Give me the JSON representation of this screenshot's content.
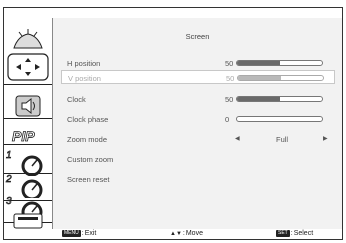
{
  "menu": {
    "title": "Screen",
    "items": [
      {
        "label": "H position",
        "value": "50",
        "level": 0.5
      },
      {
        "label": "V position",
        "value": "50",
        "level": 0.5
      },
      {
        "label": "Clock",
        "value": "50",
        "level": 0.5
      },
      {
        "label": "Clock phase",
        "value": "0",
        "level": 0.0
      },
      {
        "label": "Zoom mode",
        "option": "Full"
      },
      {
        "label": "Custom zoom"
      },
      {
        "label": "Screen reset"
      }
    ]
  },
  "sidebar": {
    "icons": [
      "picture-icon",
      "screen-icon",
      "audio-icon",
      "pip-icon",
      "config1-icon",
      "config2-icon",
      "config3-icon",
      "advanced-icon"
    ]
  },
  "footer": {
    "exit": {
      "key": "MENU",
      "label": "Exit"
    },
    "move": {
      "key": "▲▼",
      "label": "Move"
    },
    "select": {
      "key": "SET",
      "label": "Select"
    }
  },
  "colors": {
    "panel": "#f2f2f2",
    "border": "#333333",
    "slider_fill": "#6a6a6a"
  }
}
